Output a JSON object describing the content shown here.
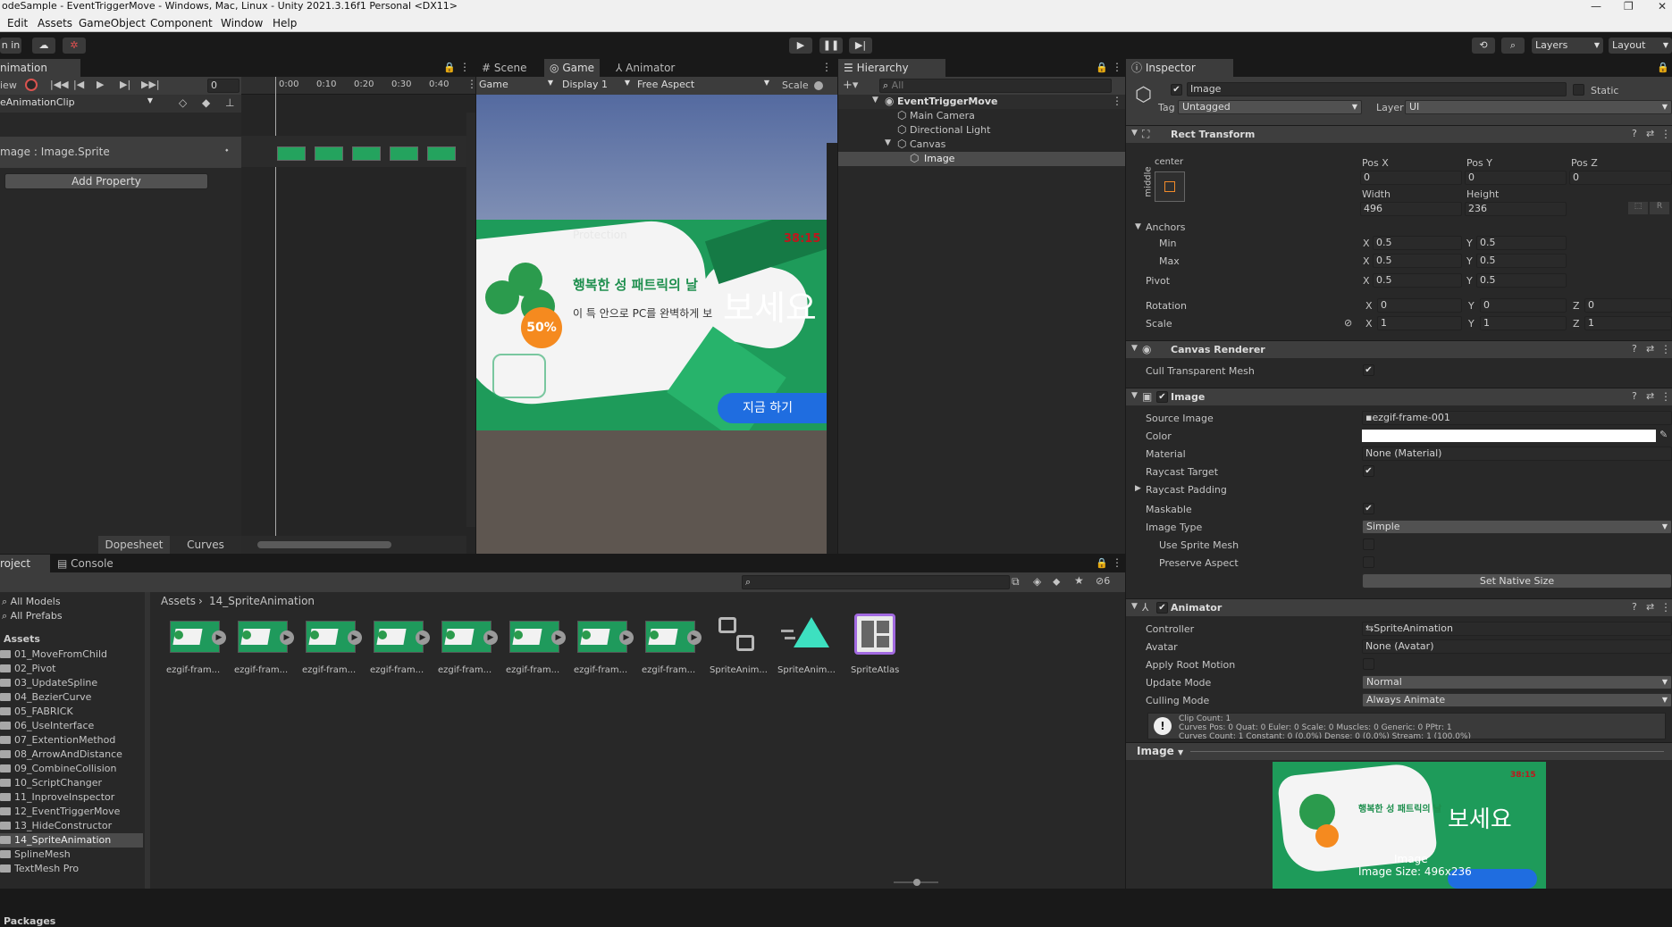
{
  "title_bar": {
    "text": "odeSample - EventTriggerMove - Windows, Mac, Linux - Unity 2021.3.16f1 Personal <DX11>",
    "minimize": "—",
    "maximize": "❐",
    "close": "✕"
  },
  "menu": [
    "Edit",
    "Assets",
    "GameObject",
    "Component",
    "Window",
    "Help"
  ],
  "toolbar": {
    "account": "n in",
    "layers": "Layers",
    "layout": "Layout"
  },
  "animation": {
    "tab": "nimation",
    "preview": "iew",
    "frame": "0",
    "clip": "eAnimationClip",
    "property": "mage : Image.Sprite",
    "add_property": "Add Property",
    "ticks": [
      "0:00",
      "0:10",
      "0:20",
      "0:30",
      "0:40"
    ],
    "dopesheet": "Dopesheet",
    "curves": "Curves"
  },
  "scene_tabs": {
    "scene": "Scene",
    "game": "Game",
    "animator": "Animator"
  },
  "game_view": {
    "display_mode": "Game",
    "display": "Display 1",
    "aspect": "Free Aspect",
    "scale_label": "Scale",
    "ad": {
      "heading": "행복한 성 패트릭의 날",
      "line": "이 특       안으로 PC를 완벽하게 보",
      "big": "보세요",
      "timer": "38:15",
      "protection": "Protection",
      "badge": "50%",
      "button": "지금     하기"
    }
  },
  "hierarchy": {
    "tab": "Hierarchy",
    "search_placeholder": "All",
    "items": [
      {
        "label": "EventTriggerMove",
        "level": 0,
        "icon": "unity-scene-icon"
      },
      {
        "label": "Main Camera",
        "level": 1,
        "icon": "gameobject-icon"
      },
      {
        "label": "Directional Light",
        "level": 1,
        "icon": "gameobject-icon"
      },
      {
        "label": "Canvas",
        "level": 1,
        "icon": "gameobject-icon"
      },
      {
        "label": "Image",
        "level": 2,
        "icon": "gameobject-icon"
      }
    ]
  },
  "inspector": {
    "tab": "Inspector",
    "name": "Image",
    "static_label": "Static",
    "tag_label": "Tag",
    "tag_value": "Untagged",
    "layer_label": "Layer",
    "layer_value": "UI",
    "rect_transform": {
      "title": "Rect Transform",
      "anchor_h": "center",
      "anchor_v": "middle",
      "posx_label": "Pos X",
      "posy_label": "Pos Y",
      "posz_label": "Pos Z",
      "posx": "0",
      "posy": "0",
      "posz": "0",
      "width_label": "Width",
      "height_label": "Height",
      "width": "496",
      "height": "236",
      "anchors_label": "Anchors",
      "min_label": "Min",
      "max_label": "Max",
      "min_x": "0.5",
      "min_y": "0.5",
      "max_x": "0.5",
      "max_y": "0.5",
      "pivot_label": "Pivot",
      "pivot_x": "0.5",
      "pivot_y": "0.5",
      "rotation_label": "Rotation",
      "rot_x": "0",
      "rot_y": "0",
      "rot_z": "0",
      "scale_label": "Scale",
      "scale_x": "1",
      "scale_y": "1",
      "scale_z": "1",
      "r_btn": "R",
      "x": "X",
      "y": "Y",
      "z": "Z"
    },
    "canvas_renderer": {
      "title": "Canvas Renderer",
      "cull_label": "Cull Transparent Mesh"
    },
    "image": {
      "title": "Image",
      "source_label": "Source Image",
      "source_value": "ezgif-frame-001",
      "color_label": "Color",
      "material_label": "Material",
      "material_value": "None (Material)",
      "raycast_label": "Raycast Target",
      "raycast_padding_label": "Raycast Padding",
      "maskable_label": "Maskable",
      "type_label": "Image Type",
      "type_value": "Simple",
      "sprite_mesh_label": "Use Sprite Mesh",
      "preserve_label": "Preserve Aspect",
      "native_size": "Set Native Size"
    },
    "animator": {
      "title": "Animator",
      "controller_label": "Controller",
      "controller_value": "SpriteAnimation",
      "avatar_label": "Avatar",
      "avatar_value": "None (Avatar)",
      "root_motion_label": "Apply Root Motion",
      "update_label": "Update Mode",
      "update_value": "Normal",
      "culling_label": "Culling Mode",
      "culling_value": "Always Animate",
      "info1": "Clip Count: 1",
      "info2": "Curves Pos: 0 Quat: 0 Euler: 0 Scale: 0 Muscles: 0 Generic: 0 PPtr: 1",
      "info3": "Curves Count: 1 Constant: 0 (0.0%) Dense: 0 (0.0%) Stream: 1 (100.0%)"
    },
    "preview": {
      "dropdown": "Image",
      "name": "Image",
      "size": "Image Size: 496x236"
    }
  },
  "project": {
    "tab_project": "roject",
    "tab_console": "Console",
    "hidden_count": "6",
    "breadcrumb": [
      "Assets",
      "14_SpriteAnimation"
    ],
    "favorites": [
      "All Models",
      "All Prefabs"
    ],
    "assets_label": "Assets",
    "folders": [
      "01_MoveFromChild",
      "02_Pivot",
      "03_UpdateSpline",
      "04_BezierCurve",
      "05_FABRICK",
      "06_UseInterface",
      "07_ExtentionMethod",
      "08_ArrowAndDistance",
      "09_CombineCollision",
      "10_ScriptChanger",
      "11_InproveInspector",
      "12_EventTriggerMove",
      "13_HideConstructor",
      "14_SpriteAnimation",
      "SplineMesh",
      "TextMesh Pro"
    ],
    "packages_label": "Packages",
    "items": [
      "ezgif-fram...",
      "ezgif-fram...",
      "ezgif-fram...",
      "ezgif-fram...",
      "ezgif-fram...",
      "ezgif-fram...",
      "ezgif-fram...",
      "ezgif-fram...",
      "SpriteAnim...",
      "SpriteAnim...",
      "SpriteAtlas"
    ]
  },
  "colors": {
    "accent_select": "#2c5d87",
    "record": "#d9534f",
    "timer_red": "#c0161c",
    "game_bg_top": "#5c76a6",
    "ad_green": "#1e9b5a",
    "ad_button": "#1f6de0"
  }
}
